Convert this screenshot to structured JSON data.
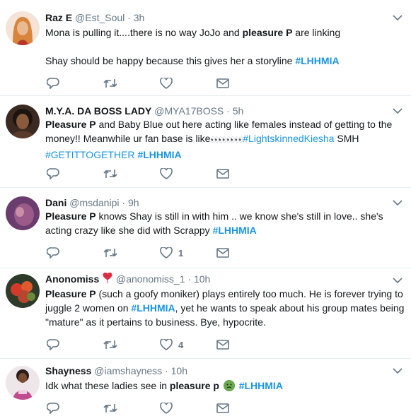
{
  "colors": {
    "link": "#1b95e0",
    "muted": "#657786",
    "text": "#14171a",
    "divider": "#e6ecf0"
  },
  "icons": {
    "reply": "reply-icon",
    "retweet": "retweet-icon",
    "like": "heart-icon",
    "dm": "envelope-icon",
    "caret": "chevron-down-icon"
  },
  "tweets": [
    {
      "name": "Raz E",
      "handle": "@Est_Soul",
      "dot": "·",
      "time": "3h",
      "text": {
        "p1": "Mona is pulling it....there is no way JoJo and ",
        "bold": "pleasure P",
        "p2": " are linking",
        "p3": "Shay should be happy because this gives her a storyline ",
        "tag": "#LHHMIA"
      },
      "likes": ""
    },
    {
      "name": "M.Y.A. DA BOSS LADY",
      "handle": "@MYA17BOSS",
      "dot": "·",
      "time": "5h",
      "text": {
        "bold": "Pleasure P",
        "p1": " and Baby Blue out here acting like females instead of getting to the money!! Meanwhile ur fan base is like",
        "eyes": "👀👀👀👀",
        "tag1": "#LightskinnedKiesha",
        "p2": " SMH",
        "tag2": "#GETITTOGETHER",
        "tag3": "#LHHMIA"
      },
      "likes": ""
    },
    {
      "name": "Dani",
      "handle": "@msdanipi",
      "dot": "·",
      "time": "9h",
      "text": {
        "bold": "Pleasure P",
        "p1": " knows Shay is still in with him .. we know she's still in love.. she's acting crazy like she did with Scrappy  ",
        "tag": "#LHHMIA"
      },
      "likes": "1"
    },
    {
      "name": "Anonomiss",
      "handle": "@anonomiss_1",
      "dot": "·",
      "time": "10h",
      "text": {
        "bold": "Pleasure P",
        "p1": " (such a goofy moniker) plays entirely too much. He is forever trying to juggle 2 women on ",
        "tag": "#LHHMIA",
        "p2": ", yet he wants to speak about his group mates being \"mature\" as it pertains to business. Bye, hypocrite."
      },
      "likes": "4"
    },
    {
      "name": "Shayness",
      "handle": "@iamshayness",
      "dot": "·",
      "time": "10h",
      "text": {
        "p1": "Idk what these ladies see in ",
        "bold": "pleasure p",
        "tag": "#LHHMIA"
      },
      "likes": ""
    }
  ]
}
